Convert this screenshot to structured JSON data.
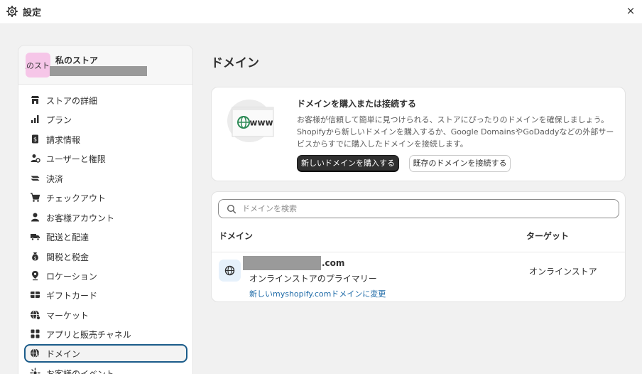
{
  "topbar": {
    "title": "設定",
    "close": "×"
  },
  "store": {
    "avatar_text": "私のスト",
    "name": "私のストア"
  },
  "sidebar": {
    "items": [
      {
        "label": "ストアの詳細",
        "icon": "store-icon"
      },
      {
        "label": "プラン",
        "icon": "plan-chart-icon"
      },
      {
        "label": "請求情報",
        "icon": "billing-icon"
      },
      {
        "label": "ユーザーと権限",
        "icon": "users-icon"
      },
      {
        "label": "決済",
        "icon": "payments-icon"
      },
      {
        "label": "チェックアウト",
        "icon": "cart-icon"
      },
      {
        "label": "お客様アカウント",
        "icon": "person-icon"
      },
      {
        "label": "配送と配達",
        "icon": "truck-icon"
      },
      {
        "label": "関税と税金",
        "icon": "money-bag-icon"
      },
      {
        "label": "ロケーション",
        "icon": "location-pin-icon"
      },
      {
        "label": "ギフトカード",
        "icon": "gift-card-icon"
      },
      {
        "label": "マーケット",
        "icon": "globe-markets-icon"
      },
      {
        "label": "アプリと販売チャネル",
        "icon": "apps-icon"
      },
      {
        "label": "ドメイン",
        "icon": "globe-domain-icon",
        "active": true
      },
      {
        "label": "お客様のイベント",
        "icon": "events-icon"
      }
    ]
  },
  "page": {
    "title": "ドメイン"
  },
  "promo": {
    "illustration_text": "www",
    "heading": "ドメインを購入または接続する",
    "description_lines": [
      "お客様が信頼して簡単に見つけられる、ストアにぴったりのドメインを確保しましょう。",
      "Shopifyから新しいドメインを購入するか、Google DomainsやGoDaddyなどの外部サー",
      "ビスからすでに購入したドメインを接続します。"
    ],
    "buy_button": "新しいドメインを購入する",
    "connect_button": "既存のドメインを接続する"
  },
  "domains": {
    "search_placeholder": "ドメインを検索",
    "col_domain": "ドメイン",
    "col_target": "ターゲット",
    "rows": [
      {
        "domain_suffix": ".com",
        "subtitle": "オンラインストアのプライマリー",
        "link": "新しいmyshopify.comドメインに変更",
        "target": "オンラインストア"
      }
    ]
  },
  "colors": {
    "accent": "#1b5c8a",
    "link": "#1f6ba8",
    "primary_button": "#303030",
    "avatar": "#f6c6e8"
  }
}
